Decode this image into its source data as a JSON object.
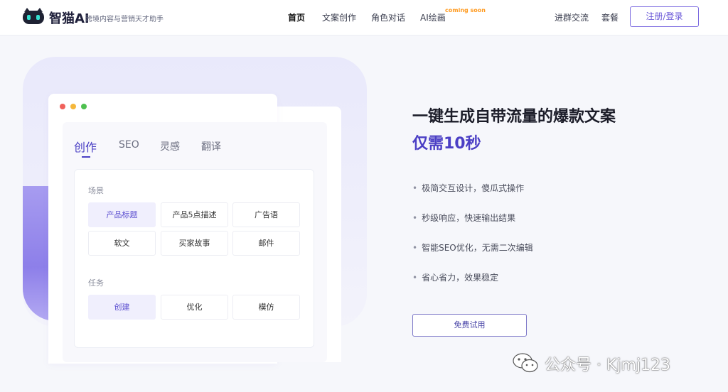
{
  "header": {
    "logo_name": "智猫AI",
    "logo_slogan": "跨境内容与营销天才助手",
    "nav": [
      {
        "label": "首页"
      },
      {
        "label": "文案创作"
      },
      {
        "label": "角色对话"
      },
      {
        "label": "AI绘画"
      }
    ],
    "coming_soon": "coming soon",
    "links": [
      {
        "label": "进群交流"
      },
      {
        "label": "套餐"
      }
    ],
    "register_label": "注册/登录"
  },
  "panel": {
    "tabs": [
      {
        "label": "创作"
      },
      {
        "label": "SEO"
      },
      {
        "label": "灵感"
      },
      {
        "label": "翻译"
      }
    ],
    "scene_label": "场景",
    "scenes": [
      {
        "label": "产品标题"
      },
      {
        "label": "产品5点描述"
      },
      {
        "label": "广告语"
      },
      {
        "label": "软文"
      },
      {
        "label": "买家故事"
      },
      {
        "label": "邮件"
      }
    ],
    "task_label": "任务",
    "tasks": [
      {
        "label": "创建"
      },
      {
        "label": "优化"
      },
      {
        "label": "模仿"
      }
    ]
  },
  "hero": {
    "headline": "一键生成自带流量的爆款文案",
    "subheadline": "仅需10秒",
    "features": [
      {
        "bullet": "•",
        "text": "极简交互设计，傻瓜式操作"
      },
      {
        "bullet": "•",
        "text": "秒级响应，快速输出结果"
      },
      {
        "bullet": "•",
        "text": "智能SEO优化，无需二次编辑"
      },
      {
        "bullet": "•",
        "text": "省心省力，效果稳定"
      }
    ],
    "trial_label": "免费试用"
  },
  "watermark": "公众号 · Kjmj123",
  "colors": {
    "accent": "#4b3fc5",
    "dot_red": "#f0615b",
    "dot_yellow": "#f5b73b",
    "dot_green": "#4ec04f",
    "coming_soon": "#ff9a1f"
  }
}
